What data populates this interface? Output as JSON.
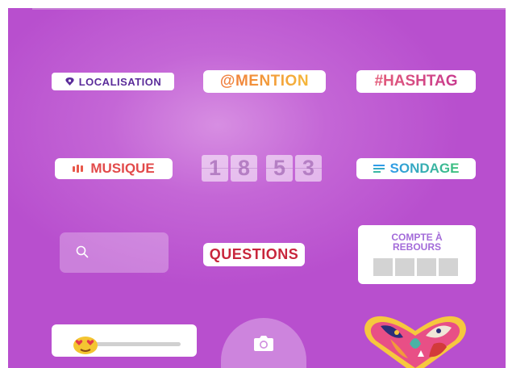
{
  "stickers": {
    "localisation": {
      "label": "LOCALISATION",
      "icon": "location-pin-icon",
      "color": "#5b2c9a"
    },
    "mention": {
      "label": "@MENTION"
    },
    "hashtag": {
      "label": "#HASHTAG"
    },
    "musique": {
      "label": "MUSIQUE",
      "icon": "sound-bars-icon",
      "color": "#e24a4a"
    },
    "countdown_digits": [
      "1",
      "8",
      "5",
      "3"
    ],
    "sondage": {
      "label": "SONDAGE",
      "icon": "poll-lines-icon"
    },
    "search": {
      "icon": "search-icon",
      "placeholder": ""
    },
    "questions": {
      "label": "QUESTIONS",
      "color": "#c8263c"
    },
    "compte_a_rebours": {
      "line1": "COMPTE À",
      "line2": "REBOURS",
      "color": "#a36bd9"
    },
    "emoji_slider": {
      "emoji": "heart-eyes-emoji"
    },
    "camera": {
      "icon": "camera-icon"
    },
    "heart": {
      "icon": "illustrated-heart-sticker"
    }
  },
  "colors": {
    "background": "#c466d6",
    "mention_gradient": [
      "#f07a3c",
      "#f5b73a"
    ],
    "hashtag_gradient": [
      "#e35d7a",
      "#c83a8e"
    ],
    "sondage_gradient": [
      "#2f9be8",
      "#3ec27a"
    ]
  }
}
